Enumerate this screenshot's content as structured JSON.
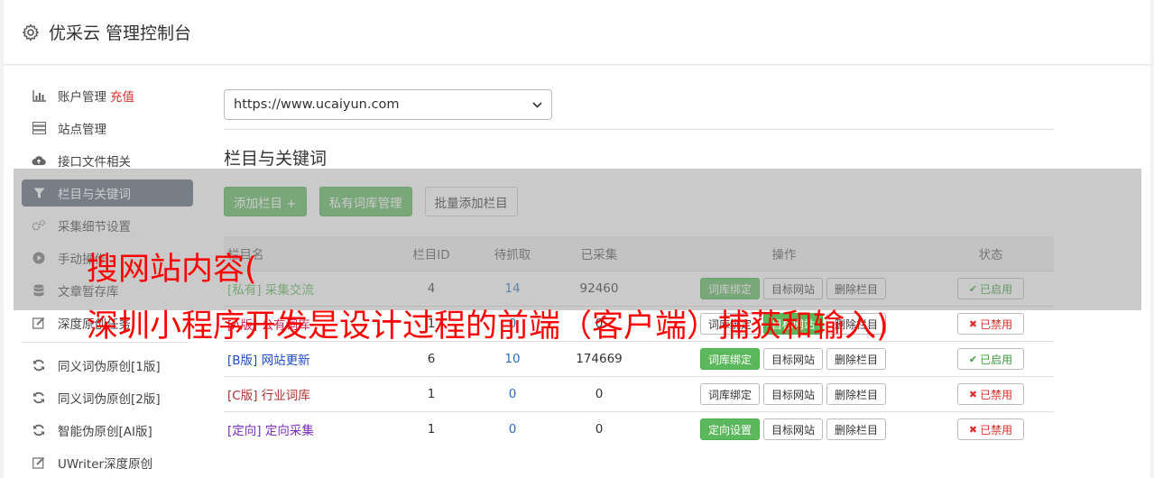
{
  "header": {
    "title": "优采云 管理控制台",
    "icon": "gear-icon"
  },
  "sidebar": {
    "items": [
      {
        "label": "账户管理",
        "extra": "充值",
        "icon": "bar-chart-icon"
      },
      {
        "label": "站点管理",
        "icon": "server-icon"
      },
      {
        "label": "接口文件相关",
        "icon": "cloud-upload-icon"
      },
      {
        "label": "栏目与关键词",
        "icon": "filter-icon",
        "active": true
      },
      {
        "label": "采集细节设置",
        "icon": "gears-icon"
      },
      {
        "label": "手动操作",
        "icon": "play-circle-icon"
      },
      {
        "label": "文章暂存库",
        "icon": "database-icon"
      },
      {
        "label": "深度原创任务",
        "icon": "edit-icon"
      }
    ],
    "items2": [
      {
        "label": "同义词伪原创[1版]",
        "icon": "refresh-icon"
      },
      {
        "label": "同义词伪原创[2版]",
        "icon": "refresh-icon"
      },
      {
        "label": "智能伪原创[AI版]",
        "icon": "refresh-icon"
      },
      {
        "label": "UWriter深度原创",
        "icon": "edit-icon"
      }
    ]
  },
  "main": {
    "site_select": "https://www.ucaiyun.com",
    "section_title": "栏目与关键词",
    "buttons": {
      "add": "添加栏目 +",
      "private_lib": "私有词库管理",
      "batch_add": "批量添加栏目"
    },
    "columns": {
      "name": "栏目名",
      "id": "栏目ID",
      "pending": "待抓取",
      "collected": "已采集",
      "ops": "操作",
      "status": "状态"
    },
    "rows": [
      {
        "tag": "[私有]",
        "name": "采集交流",
        "id": "4",
        "pending": "14",
        "collected": "92460",
        "op1": "词库绑定",
        "op1_green": true,
        "op2": "目标网站",
        "op2_green": false,
        "op3": "删除栏目",
        "status": "已启用",
        "status_on": true,
        "tag_class": "tag-private"
      },
      {
        "tag": "[A版]",
        "name": "公有词库",
        "id": "1",
        "pending": "0",
        "collected": "0",
        "op1": "词库绑定",
        "op1_green": false,
        "op2": "目标网站",
        "op2_green": true,
        "op3": "删除栏目",
        "status": "已禁用",
        "status_on": false,
        "tag_class": "tag-a"
      },
      {
        "tag": "[B版]",
        "name": "网站更新",
        "id": "6",
        "pending": "10",
        "collected": "174669",
        "op1": "词库绑定",
        "op1_green": true,
        "op2": "目标网站",
        "op2_green": false,
        "op3": "删除栏目",
        "status": "已启用",
        "status_on": true,
        "tag_class": "tag-b"
      },
      {
        "tag": "[C版]",
        "name": "行业词库",
        "id": "1",
        "pending": "0",
        "collected": "0",
        "op1": "词库绑定",
        "op1_green": false,
        "op2": "目标网站",
        "op2_green": false,
        "op3": "删除栏目",
        "status": "已禁用",
        "status_on": false,
        "tag_class": "tag-c"
      },
      {
        "tag": "[定向]",
        "name": "定向采集",
        "id": "1",
        "pending": "0",
        "collected": "0",
        "op1": "定向设置",
        "op1_green": true,
        "op2": "目标网站",
        "op2_green": false,
        "op3": "删除栏目",
        "status": "已禁用",
        "status_on": false,
        "tag_class": "tag-d"
      }
    ]
  },
  "overlay": {
    "line1": "搜网站内容(",
    "line2": "深圳小程序开发是设计过程的前端（客户端）捕获和输入)"
  },
  "colors": {
    "accent_green": "#5cb85c",
    "active_sidebar": "#5b6778",
    "overlay_text": "#ff0000"
  }
}
